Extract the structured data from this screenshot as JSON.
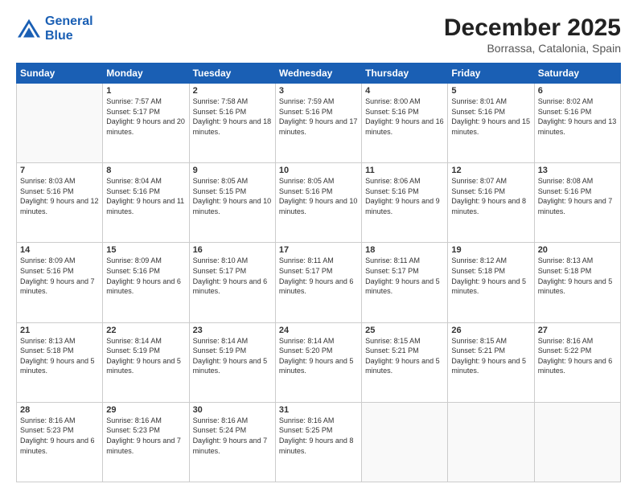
{
  "header": {
    "logo_line1": "General",
    "logo_line2": "Blue",
    "month": "December 2025",
    "location": "Borrassa, Catalonia, Spain"
  },
  "weekdays": [
    "Sunday",
    "Monday",
    "Tuesday",
    "Wednesday",
    "Thursday",
    "Friday",
    "Saturday"
  ],
  "weeks": [
    [
      {
        "day": "",
        "empty": true
      },
      {
        "day": "1",
        "sunrise": "7:57 AM",
        "sunset": "5:17 PM",
        "daylight": "9 hours and 20 minutes."
      },
      {
        "day": "2",
        "sunrise": "7:58 AM",
        "sunset": "5:16 PM",
        "daylight": "9 hours and 18 minutes."
      },
      {
        "day": "3",
        "sunrise": "7:59 AM",
        "sunset": "5:16 PM",
        "daylight": "9 hours and 17 minutes."
      },
      {
        "day": "4",
        "sunrise": "8:00 AM",
        "sunset": "5:16 PM",
        "daylight": "9 hours and 16 minutes."
      },
      {
        "day": "5",
        "sunrise": "8:01 AM",
        "sunset": "5:16 PM",
        "daylight": "9 hours and 15 minutes."
      },
      {
        "day": "6",
        "sunrise": "8:02 AM",
        "sunset": "5:16 PM",
        "daylight": "9 hours and 13 minutes."
      }
    ],
    [
      {
        "day": "7",
        "sunrise": "8:03 AM",
        "sunset": "5:16 PM",
        "daylight": "9 hours and 12 minutes."
      },
      {
        "day": "8",
        "sunrise": "8:04 AM",
        "sunset": "5:16 PM",
        "daylight": "9 hours and 11 minutes."
      },
      {
        "day": "9",
        "sunrise": "8:05 AM",
        "sunset": "5:15 PM",
        "daylight": "9 hours and 10 minutes."
      },
      {
        "day": "10",
        "sunrise": "8:05 AM",
        "sunset": "5:16 PM",
        "daylight": "9 hours and 10 minutes."
      },
      {
        "day": "11",
        "sunrise": "8:06 AM",
        "sunset": "5:16 PM",
        "daylight": "9 hours and 9 minutes."
      },
      {
        "day": "12",
        "sunrise": "8:07 AM",
        "sunset": "5:16 PM",
        "daylight": "9 hours and 8 minutes."
      },
      {
        "day": "13",
        "sunrise": "8:08 AM",
        "sunset": "5:16 PM",
        "daylight": "9 hours and 7 minutes."
      }
    ],
    [
      {
        "day": "14",
        "sunrise": "8:09 AM",
        "sunset": "5:16 PM",
        "daylight": "9 hours and 7 minutes."
      },
      {
        "day": "15",
        "sunrise": "8:09 AM",
        "sunset": "5:16 PM",
        "daylight": "9 hours and 6 minutes."
      },
      {
        "day": "16",
        "sunrise": "8:10 AM",
        "sunset": "5:17 PM",
        "daylight": "9 hours and 6 minutes."
      },
      {
        "day": "17",
        "sunrise": "8:11 AM",
        "sunset": "5:17 PM",
        "daylight": "9 hours and 6 minutes."
      },
      {
        "day": "18",
        "sunrise": "8:11 AM",
        "sunset": "5:17 PM",
        "daylight": "9 hours and 5 minutes."
      },
      {
        "day": "19",
        "sunrise": "8:12 AM",
        "sunset": "5:18 PM",
        "daylight": "9 hours and 5 minutes."
      },
      {
        "day": "20",
        "sunrise": "8:13 AM",
        "sunset": "5:18 PM",
        "daylight": "9 hours and 5 minutes."
      }
    ],
    [
      {
        "day": "21",
        "sunrise": "8:13 AM",
        "sunset": "5:18 PM",
        "daylight": "9 hours and 5 minutes."
      },
      {
        "day": "22",
        "sunrise": "8:14 AM",
        "sunset": "5:19 PM",
        "daylight": "9 hours and 5 minutes."
      },
      {
        "day": "23",
        "sunrise": "8:14 AM",
        "sunset": "5:19 PM",
        "daylight": "9 hours and 5 minutes."
      },
      {
        "day": "24",
        "sunrise": "8:14 AM",
        "sunset": "5:20 PM",
        "daylight": "9 hours and 5 minutes."
      },
      {
        "day": "25",
        "sunrise": "8:15 AM",
        "sunset": "5:21 PM",
        "daylight": "9 hours and 5 minutes."
      },
      {
        "day": "26",
        "sunrise": "8:15 AM",
        "sunset": "5:21 PM",
        "daylight": "9 hours and 5 minutes."
      },
      {
        "day": "27",
        "sunrise": "8:16 AM",
        "sunset": "5:22 PM",
        "daylight": "9 hours and 6 minutes."
      }
    ],
    [
      {
        "day": "28",
        "sunrise": "8:16 AM",
        "sunset": "5:23 PM",
        "daylight": "9 hours and 6 minutes."
      },
      {
        "day": "29",
        "sunrise": "8:16 AM",
        "sunset": "5:23 PM",
        "daylight": "9 hours and 7 minutes."
      },
      {
        "day": "30",
        "sunrise": "8:16 AM",
        "sunset": "5:24 PM",
        "daylight": "9 hours and 7 minutes."
      },
      {
        "day": "31",
        "sunrise": "8:16 AM",
        "sunset": "5:25 PM",
        "daylight": "9 hours and 8 minutes."
      },
      {
        "day": "",
        "empty": true
      },
      {
        "day": "",
        "empty": true
      },
      {
        "day": "",
        "empty": true
      }
    ]
  ],
  "labels": {
    "sunrise": "Sunrise:",
    "sunset": "Sunset:",
    "daylight": "Daylight:"
  }
}
